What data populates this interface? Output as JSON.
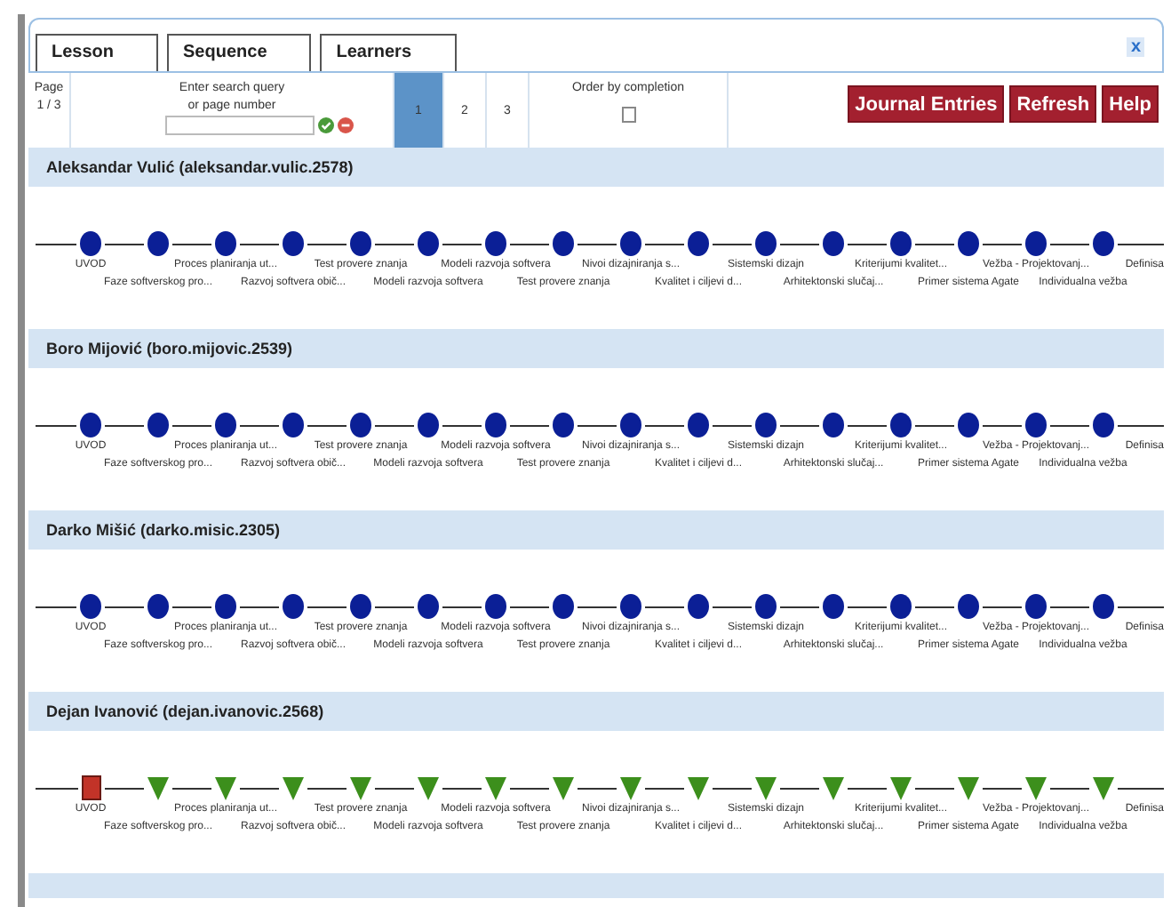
{
  "tabs": [
    {
      "label": "Lesson"
    },
    {
      "label": "Sequence"
    },
    {
      "label": "Learners"
    }
  ],
  "close": "x",
  "toolbar": {
    "page_label": "Page",
    "page_count": "1 / 3",
    "search_hint": [
      "Enter search query",
      "or page number"
    ],
    "pages": [
      {
        "label": "1",
        "selected": true
      },
      {
        "label": "2",
        "selected": false
      },
      {
        "label": "3",
        "selected": false
      }
    ],
    "order_label": "Order by completion",
    "order_checked": false,
    "buttons": [
      "Journal Entries",
      "Refresh",
      "Help"
    ]
  },
  "learners": [
    {
      "name": "Aleksandar Vulić (aleksandar.vulic.2578)",
      "activities": [
        {
          "label": "UVOD",
          "kind": "completed"
        },
        {
          "label": "Faze softverskog pro...",
          "kind": "completed"
        },
        {
          "label": "Proces planiranja ut...",
          "kind": "completed"
        },
        {
          "label": "Razvoj softvera obič...",
          "kind": "completed"
        },
        {
          "label": "Test provere znanja",
          "kind": "completed"
        },
        {
          "label": "Modeli razvoja softvera",
          "kind": "completed"
        },
        {
          "label": "Modeli razvoja softvera",
          "kind": "completed"
        },
        {
          "label": "Test provere znanja",
          "kind": "completed"
        },
        {
          "label": "Nivoi dizajniranja s...",
          "kind": "completed"
        },
        {
          "label": "Kvalitet i ciljevi d...",
          "kind": "completed"
        },
        {
          "label": "Sistemski dizajn",
          "kind": "completed"
        },
        {
          "label": "Arhitektonski slučaj...",
          "kind": "completed"
        },
        {
          "label": "Kriterijumi kvalitet...",
          "kind": "completed"
        },
        {
          "label": "Primer sistema Agate",
          "kind": "completed"
        },
        {
          "label": "Vežba - Projektovanj...",
          "kind": "completed"
        },
        {
          "label": "Individualna vežba",
          "kind": "completed"
        },
        {
          "label": "Definisa"
        }
      ]
    },
    {
      "name": "Boro Mijović (boro.mijovic.2539)",
      "activities": [
        {
          "label": "UVOD",
          "kind": "completed"
        },
        {
          "label": "Faze softverskog pro...",
          "kind": "completed"
        },
        {
          "label": "Proces planiranja ut...",
          "kind": "completed"
        },
        {
          "label": "Razvoj softvera obič...",
          "kind": "completed"
        },
        {
          "label": "Test provere znanja",
          "kind": "completed"
        },
        {
          "label": "Modeli razvoja softvera",
          "kind": "completed"
        },
        {
          "label": "Modeli razvoja softvera",
          "kind": "completed"
        },
        {
          "label": "Test provere znanja",
          "kind": "completed"
        },
        {
          "label": "Nivoi dizajniranja s...",
          "kind": "completed"
        },
        {
          "label": "Kvalitet i ciljevi d...",
          "kind": "completed"
        },
        {
          "label": "Sistemski dizajn",
          "kind": "completed"
        },
        {
          "label": "Arhitektonski slučaj...",
          "kind": "completed"
        },
        {
          "label": "Kriterijumi kvalitet...",
          "kind": "completed"
        },
        {
          "label": "Primer sistema Agate",
          "kind": "completed"
        },
        {
          "label": "Vežba - Projektovanj...",
          "kind": "completed"
        },
        {
          "label": "Individualna vežba",
          "kind": "completed"
        },
        {
          "label": "Definisa"
        }
      ]
    },
    {
      "name": "Darko Mišić (darko.misic.2305)",
      "activities": [
        {
          "label": "UVOD",
          "kind": "completed"
        },
        {
          "label": "Faze softverskog pro...",
          "kind": "completed"
        },
        {
          "label": "Proces planiranja ut...",
          "kind": "completed"
        },
        {
          "label": "Razvoj softvera obič...",
          "kind": "completed"
        },
        {
          "label": "Test provere znanja",
          "kind": "completed"
        },
        {
          "label": "Modeli razvoja softvera",
          "kind": "completed"
        },
        {
          "label": "Modeli razvoja softvera",
          "kind": "completed"
        },
        {
          "label": "Test provere znanja",
          "kind": "completed"
        },
        {
          "label": "Nivoi dizajniranja s...",
          "kind": "completed"
        },
        {
          "label": "Kvalitet i ciljevi d...",
          "kind": "completed"
        },
        {
          "label": "Sistemski dizajn",
          "kind": "completed"
        },
        {
          "label": "Arhitektonski slučaj...",
          "kind": "completed"
        },
        {
          "label": "Kriterijumi kvalitet...",
          "kind": "completed"
        },
        {
          "label": "Primer sistema Agate",
          "kind": "completed"
        },
        {
          "label": "Vežba - Projektovanj...",
          "kind": "completed"
        },
        {
          "label": "Individualna vežba",
          "kind": "completed"
        },
        {
          "label": "Definisa"
        }
      ]
    },
    {
      "name": "Dejan Ivanović (dejan.ivanovic.2568)",
      "activities": [
        {
          "label": "UVOD",
          "kind": "current"
        },
        {
          "label": "Faze softverskog pro...",
          "kind": "pending"
        },
        {
          "label": "Proces planiranja ut...",
          "kind": "pending"
        },
        {
          "label": "Razvoj softvera obič...",
          "kind": "pending"
        },
        {
          "label": "Test provere znanja",
          "kind": "pending"
        },
        {
          "label": "Modeli razvoja softvera",
          "kind": "pending"
        },
        {
          "label": "Modeli razvoja softvera",
          "kind": "pending"
        },
        {
          "label": "Test provere znanja",
          "kind": "pending"
        },
        {
          "label": "Nivoi dizajniranja s...",
          "kind": "pending"
        },
        {
          "label": "Kvalitet i ciljevi d...",
          "kind": "pending"
        },
        {
          "label": "Sistemski dizajn",
          "kind": "pending"
        },
        {
          "label": "Arhitektonski slučaj...",
          "kind": "pending"
        },
        {
          "label": "Kriterijumi kvalitet...",
          "kind": "pending"
        },
        {
          "label": "Primer sistema Agate",
          "kind": "pending"
        },
        {
          "label": "Vežba - Projektovanj...",
          "kind": "pending"
        },
        {
          "label": "Individualna vežba",
          "kind": "pending"
        },
        {
          "label": "Definisa"
        }
      ]
    }
  ]
}
